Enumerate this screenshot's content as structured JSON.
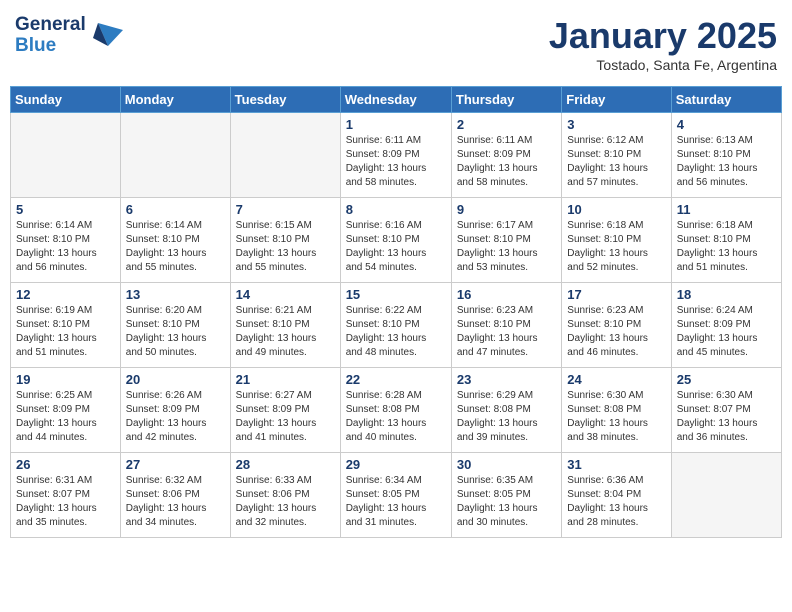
{
  "header": {
    "logo_line1": "General",
    "logo_line2": "Blue",
    "month": "January 2025",
    "location": "Tostado, Santa Fe, Argentina"
  },
  "weekdays": [
    "Sunday",
    "Monday",
    "Tuesday",
    "Wednesday",
    "Thursday",
    "Friday",
    "Saturday"
  ],
  "weeks": [
    [
      {
        "day": "",
        "info": ""
      },
      {
        "day": "",
        "info": ""
      },
      {
        "day": "",
        "info": ""
      },
      {
        "day": "1",
        "info": "Sunrise: 6:11 AM\nSunset: 8:09 PM\nDaylight: 13 hours\nand 58 minutes."
      },
      {
        "day": "2",
        "info": "Sunrise: 6:11 AM\nSunset: 8:09 PM\nDaylight: 13 hours\nand 58 minutes."
      },
      {
        "day": "3",
        "info": "Sunrise: 6:12 AM\nSunset: 8:10 PM\nDaylight: 13 hours\nand 57 minutes."
      },
      {
        "day": "4",
        "info": "Sunrise: 6:13 AM\nSunset: 8:10 PM\nDaylight: 13 hours\nand 56 minutes."
      }
    ],
    [
      {
        "day": "5",
        "info": "Sunrise: 6:14 AM\nSunset: 8:10 PM\nDaylight: 13 hours\nand 56 minutes."
      },
      {
        "day": "6",
        "info": "Sunrise: 6:14 AM\nSunset: 8:10 PM\nDaylight: 13 hours\nand 55 minutes."
      },
      {
        "day": "7",
        "info": "Sunrise: 6:15 AM\nSunset: 8:10 PM\nDaylight: 13 hours\nand 55 minutes."
      },
      {
        "day": "8",
        "info": "Sunrise: 6:16 AM\nSunset: 8:10 PM\nDaylight: 13 hours\nand 54 minutes."
      },
      {
        "day": "9",
        "info": "Sunrise: 6:17 AM\nSunset: 8:10 PM\nDaylight: 13 hours\nand 53 minutes."
      },
      {
        "day": "10",
        "info": "Sunrise: 6:18 AM\nSunset: 8:10 PM\nDaylight: 13 hours\nand 52 minutes."
      },
      {
        "day": "11",
        "info": "Sunrise: 6:18 AM\nSunset: 8:10 PM\nDaylight: 13 hours\nand 51 minutes."
      }
    ],
    [
      {
        "day": "12",
        "info": "Sunrise: 6:19 AM\nSunset: 8:10 PM\nDaylight: 13 hours\nand 51 minutes."
      },
      {
        "day": "13",
        "info": "Sunrise: 6:20 AM\nSunset: 8:10 PM\nDaylight: 13 hours\nand 50 minutes."
      },
      {
        "day": "14",
        "info": "Sunrise: 6:21 AM\nSunset: 8:10 PM\nDaylight: 13 hours\nand 49 minutes."
      },
      {
        "day": "15",
        "info": "Sunrise: 6:22 AM\nSunset: 8:10 PM\nDaylight: 13 hours\nand 48 minutes."
      },
      {
        "day": "16",
        "info": "Sunrise: 6:23 AM\nSunset: 8:10 PM\nDaylight: 13 hours\nand 47 minutes."
      },
      {
        "day": "17",
        "info": "Sunrise: 6:23 AM\nSunset: 8:10 PM\nDaylight: 13 hours\nand 46 minutes."
      },
      {
        "day": "18",
        "info": "Sunrise: 6:24 AM\nSunset: 8:09 PM\nDaylight: 13 hours\nand 45 minutes."
      }
    ],
    [
      {
        "day": "19",
        "info": "Sunrise: 6:25 AM\nSunset: 8:09 PM\nDaylight: 13 hours\nand 44 minutes."
      },
      {
        "day": "20",
        "info": "Sunrise: 6:26 AM\nSunset: 8:09 PM\nDaylight: 13 hours\nand 42 minutes."
      },
      {
        "day": "21",
        "info": "Sunrise: 6:27 AM\nSunset: 8:09 PM\nDaylight: 13 hours\nand 41 minutes."
      },
      {
        "day": "22",
        "info": "Sunrise: 6:28 AM\nSunset: 8:08 PM\nDaylight: 13 hours\nand 40 minutes."
      },
      {
        "day": "23",
        "info": "Sunrise: 6:29 AM\nSunset: 8:08 PM\nDaylight: 13 hours\nand 39 minutes."
      },
      {
        "day": "24",
        "info": "Sunrise: 6:30 AM\nSunset: 8:08 PM\nDaylight: 13 hours\nand 38 minutes."
      },
      {
        "day": "25",
        "info": "Sunrise: 6:30 AM\nSunset: 8:07 PM\nDaylight: 13 hours\nand 36 minutes."
      }
    ],
    [
      {
        "day": "26",
        "info": "Sunrise: 6:31 AM\nSunset: 8:07 PM\nDaylight: 13 hours\nand 35 minutes."
      },
      {
        "day": "27",
        "info": "Sunrise: 6:32 AM\nSunset: 8:06 PM\nDaylight: 13 hours\nand 34 minutes."
      },
      {
        "day": "28",
        "info": "Sunrise: 6:33 AM\nSunset: 8:06 PM\nDaylight: 13 hours\nand 32 minutes."
      },
      {
        "day": "29",
        "info": "Sunrise: 6:34 AM\nSunset: 8:05 PM\nDaylight: 13 hours\nand 31 minutes."
      },
      {
        "day": "30",
        "info": "Sunrise: 6:35 AM\nSunset: 8:05 PM\nDaylight: 13 hours\nand 30 minutes."
      },
      {
        "day": "31",
        "info": "Sunrise: 6:36 AM\nSunset: 8:04 PM\nDaylight: 13 hours\nand 28 minutes."
      },
      {
        "day": "",
        "info": ""
      }
    ]
  ]
}
